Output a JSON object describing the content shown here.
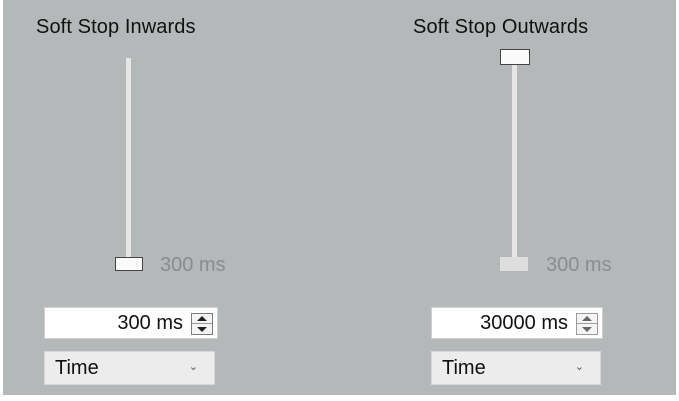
{
  "inwards": {
    "title": "Soft Stop Inwards",
    "min_label": "300 ms",
    "spin_value": "300 ms",
    "mode": "Time",
    "slider_level": 0
  },
  "outwards": {
    "title": "Soft Stop Outwards",
    "min_label": "300 ms",
    "spin_value": "30000 ms",
    "mode": "Time",
    "slider_level": 1
  }
}
